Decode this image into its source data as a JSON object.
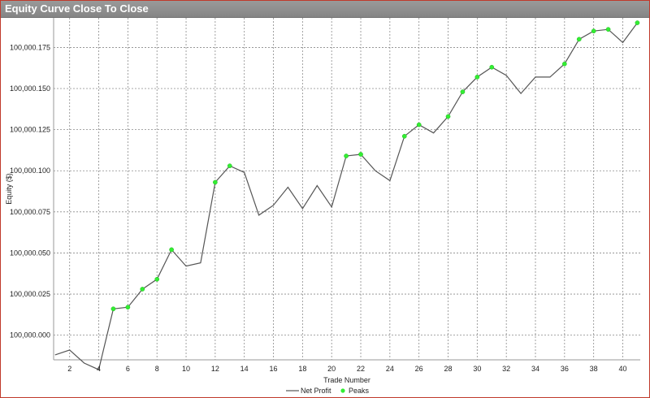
{
  "window": {
    "title": "Equity Curve Close To Close"
  },
  "chart_data": {
    "type": "line",
    "title": "",
    "xlabel": "Trade Number",
    "ylabel": "Equity ($)",
    "xlim": [
      0.9,
      41.2
    ],
    "ylim": [
      99999.985,
      100000.193
    ],
    "xticks": [
      2,
      4,
      6,
      8,
      10,
      12,
      14,
      16,
      18,
      20,
      22,
      24,
      26,
      28,
      30,
      32,
      34,
      36,
      38,
      40
    ],
    "yticks": [
      100000.0,
      100000.025,
      100000.05,
      100000.075,
      100000.1,
      100000.125,
      100000.15,
      100000.175
    ],
    "ytick_labels": [
      "100,000.000",
      "100,000.025",
      "100,000.050",
      "100,000.075",
      "100,000.100",
      "100,000.125",
      "100,000.150",
      "100,000.175"
    ],
    "grid": true,
    "legend_position": "bottom-center",
    "series": [
      {
        "name": "Net Profit",
        "color": "#555555",
        "x": [
          1,
          2,
          3,
          4,
          5,
          6,
          7,
          8,
          9,
          10,
          11,
          12,
          13,
          14,
          15,
          16,
          17,
          18,
          19,
          20,
          21,
          22,
          23,
          24,
          25,
          26,
          27,
          28,
          29,
          30,
          31,
          32,
          33,
          34,
          35,
          36,
          37,
          38,
          39,
          40,
          41
        ],
        "y": [
          99999.988,
          99999.991,
          99999.983,
          99999.979,
          100000.016,
          100000.017,
          100000.028,
          100000.034,
          100000.052,
          100000.042,
          100000.044,
          100000.093,
          100000.103,
          100000.099,
          100000.073,
          100000.079,
          100000.09,
          100000.077,
          100000.091,
          100000.078,
          100000.109,
          100000.11,
          100000.1,
          100000.094,
          100000.121,
          100000.128,
          100000.123,
          100000.133,
          100000.148,
          100000.157,
          100000.163,
          100000.158,
          100000.147,
          100000.157,
          100000.157,
          100000.165,
          100000.18,
          100000.185,
          100000.186,
          100000.178,
          100000.19
        ]
      },
      {
        "name": "Peaks",
        "color": "#33ee33",
        "marker": "circle",
        "x": [
          5,
          6,
          7,
          8,
          9,
          12,
          13,
          21,
          22,
          25,
          26,
          28,
          29,
          30,
          31,
          36,
          37,
          38,
          39,
          41
        ],
        "y": [
          100000.016,
          100000.017,
          100000.028,
          100000.034,
          100000.052,
          100000.093,
          100000.103,
          100000.109,
          100000.11,
          100000.121,
          100000.128,
          100000.133,
          100000.148,
          100000.157,
          100000.163,
          100000.165,
          100000.18,
          100000.185,
          100000.186,
          100000.19
        ]
      }
    ]
  }
}
